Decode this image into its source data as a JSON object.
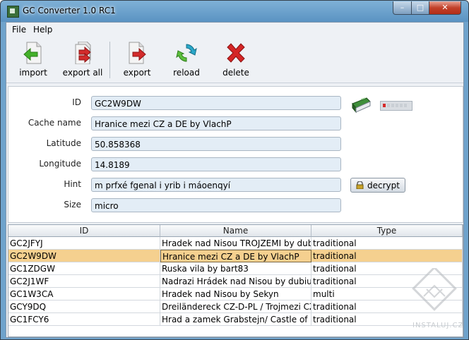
{
  "window": {
    "title": "GC Converter 1.0 RC1",
    "min": "–",
    "max": "□",
    "close": "✕"
  },
  "menu": {
    "file": "File",
    "help": "Help"
  },
  "toolbar": {
    "import": "import",
    "export_all": "export all",
    "export": "export",
    "reload": "reload",
    "delete": "delete"
  },
  "form": {
    "id_label": "ID",
    "id_value": "GC2W9DW",
    "name_label": "Cache name",
    "name_value": "Hranice mezi CZ a DE by VlachP",
    "lat_label": "Latitude",
    "lat_value": "50.858368",
    "lon_label": "Longitude",
    "lon_value": "14.8189",
    "hint_label": "Hint",
    "hint_value": "m prfxé fgenal i yrib i máoenqyí",
    "size_label": "Size",
    "size_value": "micro",
    "decrypt": "decrypt"
  },
  "table": {
    "columns": [
      "ID",
      "Name",
      "Type"
    ],
    "rows": [
      {
        "id": "GC2JFYJ",
        "name": "Hradek nad Nisou TROJZEMI by dubi...",
        "type": "traditional"
      },
      {
        "id": "GC2W9DW",
        "name": "Hranice mezi CZ a DE by VlachP",
        "type": "traditional"
      },
      {
        "id": "GC1ZDGW",
        "name": "Ruska vila by bart83",
        "type": "traditional"
      },
      {
        "id": "GC2J1WF",
        "name": "Nadrazi Hrádek nad Nisou by dubiusD",
        "type": "traditional"
      },
      {
        "id": "GC1W3CA",
        "name": "Hradek nad Nisou by Sekyn",
        "type": "multi"
      },
      {
        "id": "GCY9DQ",
        "name": "Dreiländereck CZ-D-PL / Trojmezi CZ-...",
        "type": "traditional"
      },
      {
        "id": "GC1FCY6",
        "name": "Hrad a zamek Grabstejn/ Castle of Gra...",
        "type": "traditional"
      }
    ],
    "selected_index": 1
  },
  "watermark": {
    "text": "INSTALUJ.CZ"
  },
  "colors": {
    "selection": "#f5d08f",
    "field_bg": "#e3edf6",
    "titlebar": "#6fa3cc"
  }
}
